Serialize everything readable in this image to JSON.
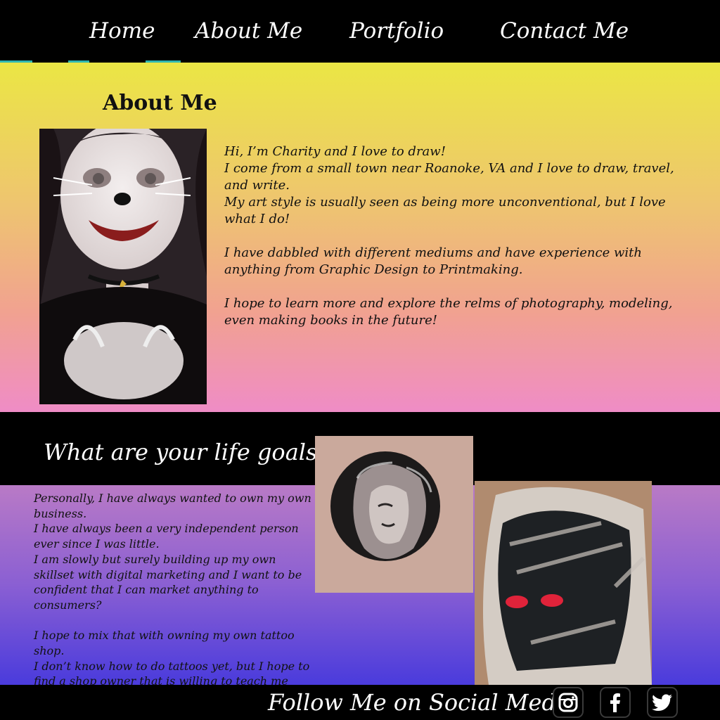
{
  "nav": {
    "items": [
      {
        "label": "Home"
      },
      {
        "label": "About Me"
      },
      {
        "label": "Portfolio"
      },
      {
        "label": "Contact Me"
      }
    ]
  },
  "about": {
    "title": "About Me",
    "paragraphs": [
      "Hi, I’m Charity and I love to draw!",
      "I come from a small town near Roanoke, VA and I love to draw, travel, and write.",
      "My art style is usually seen as being more unconventional, but I love what I do!",
      "I have dabbled with different mediums and have experience with anything from Graphic Design to Printmaking.",
      "I hope to learn more and explore the relms of photography, modeling, even making books in the future!"
    ]
  },
  "goals": {
    "title": "What are your life goals?",
    "paragraphs": [
      "Personally, I have always wanted to own my own business.",
      "I have always been a very independent person ever since I was little.",
      "I am slowly but surely building up my own skillset with digital marketing and I want to be confident that I can market anything to consumers?",
      "I hope to mix that with owning my own tattoo shop.",
      "I don’t know how to do tattoos yet, but I hope to find a shop owner that is willing to teach me (maybe even trade our skills!)."
    ]
  },
  "footer": {
    "follow_label": "Follow Me on Social Media-",
    "social": [
      {
        "icon": "instagram-icon"
      },
      {
        "icon": "facebook-icon"
      },
      {
        "icon": "twitter-icon"
      }
    ]
  },
  "colors": {
    "nav_bg": "#000000",
    "nav_accent": "#2fb6b0",
    "about_gradient_top": "#ebe644",
    "about_gradient_bottom": "#ef8cc6",
    "goals_gradient_top": "#b97ac6",
    "goals_gradient_bottom": "#4a3bdc"
  }
}
